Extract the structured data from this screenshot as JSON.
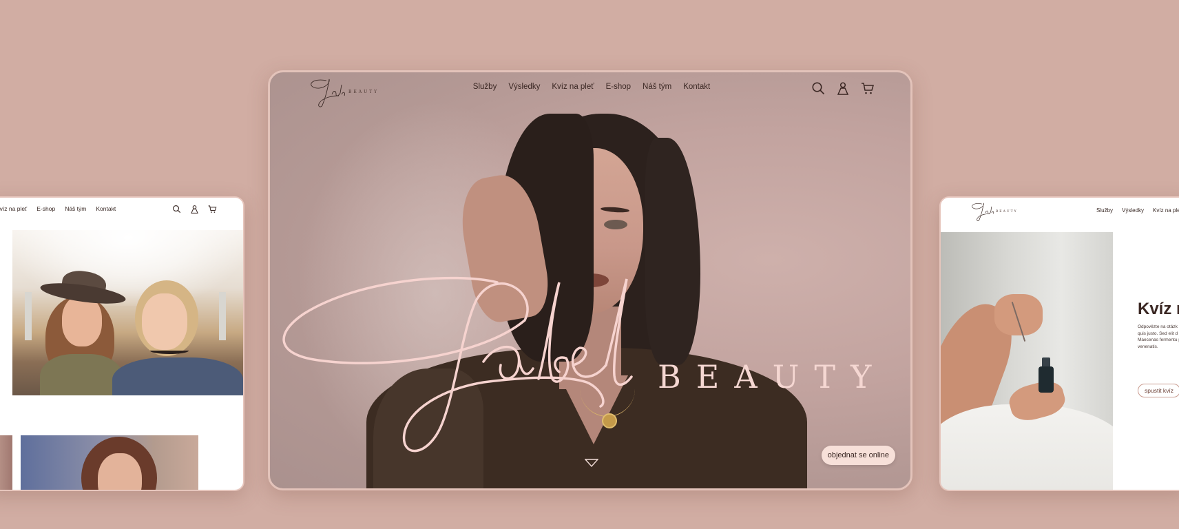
{
  "colors": {
    "background": "#d1ada3",
    "card_border": "#e7c6bd",
    "script_pink": "#f6d3cf",
    "button_bg": "#f7e0d9",
    "text_dark": "#3a2723"
  },
  "left_card": {
    "nav": [
      "Kvíz na pleť",
      "E-shop",
      "Náš tým",
      "Kontakt"
    ],
    "icons": [
      "search-icon",
      "user-icon",
      "cart-icon"
    ]
  },
  "main_card": {
    "logo": {
      "script": "Jabel",
      "word": "BEAUTY"
    },
    "nav": [
      "Služby",
      "Výsledky",
      "Kvíz na pleť",
      "E-shop",
      "Náš tým",
      "Kontakt"
    ],
    "icons": [
      "search-icon",
      "user-icon",
      "cart-icon"
    ],
    "hero": {
      "script": "Jabel",
      "word": "BEAUTY"
    },
    "scroll_icon": "chevron-down-icon",
    "cta": "objednat se online"
  },
  "right_card": {
    "logo": {
      "script": "Jabel",
      "word": "BEAUTY"
    },
    "nav": [
      "Služby",
      "Výsledky",
      "Kvíz na pleť"
    ],
    "quiz_title": "Kvíz n",
    "quiz_text": "Odpovězte na otázk Lorem ipsum dolor s quis justo. Sed elit d scelerisque luctus v Maecenas fermentu pharetra metus odio venenatis.",
    "quiz_button": "spustit kvíz"
  }
}
